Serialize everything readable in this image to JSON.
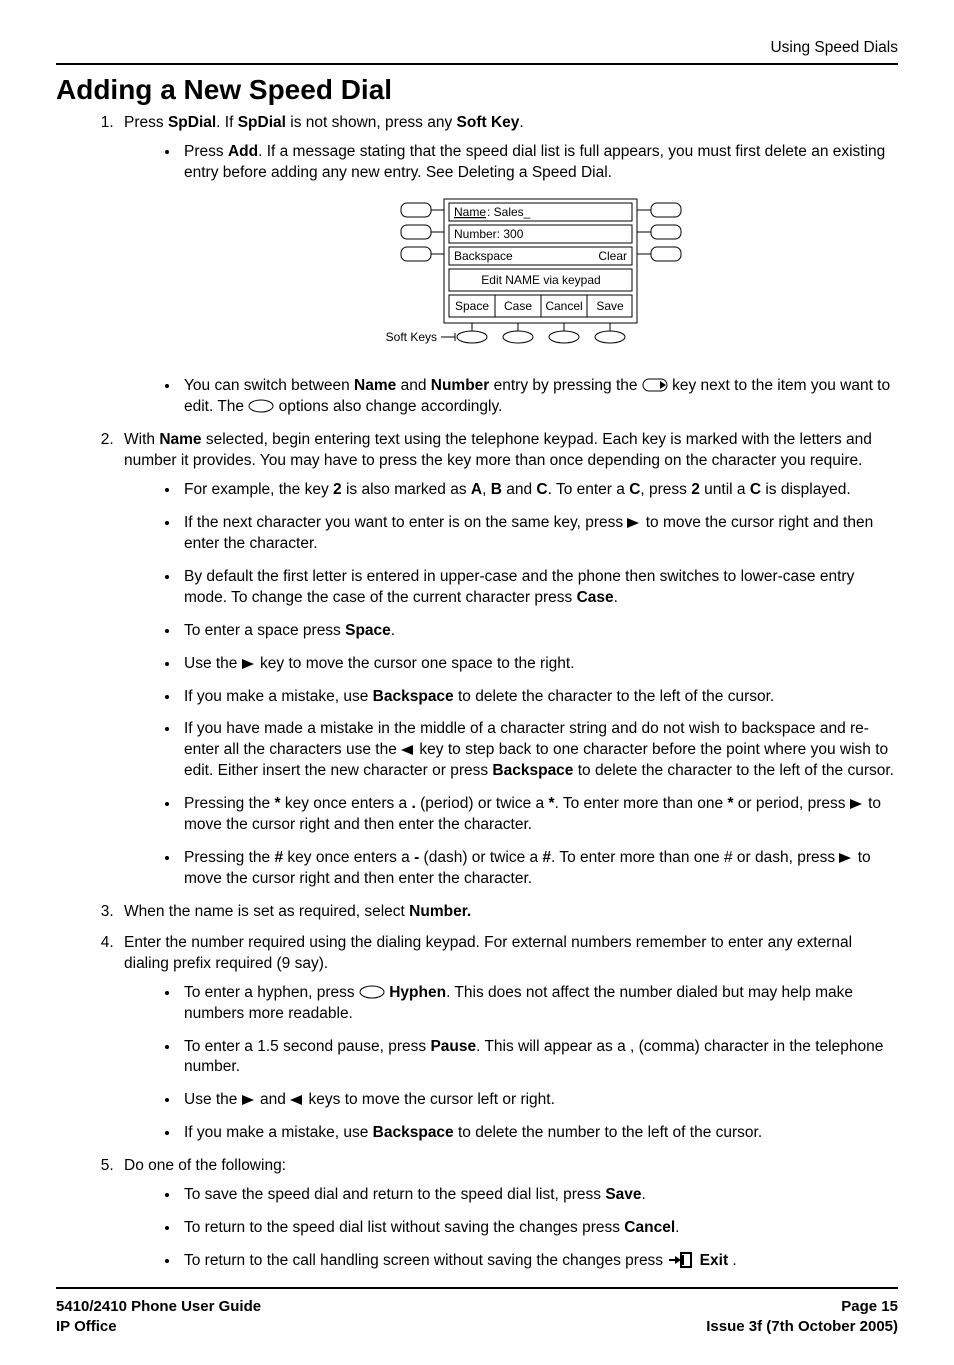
{
  "header": {
    "section": "Using Speed Dials"
  },
  "title": "Adding a New Speed Dial",
  "step1": {
    "line": {
      "p1": "Press ",
      "b1": "SpDial",
      "p2": ". If ",
      "b2": "SpDial",
      "p3": " is not shown, press any ",
      "b3": "Soft Key",
      "p4": "."
    },
    "bul1": {
      "p1": "Press ",
      "b1": "Add",
      "p2": ". If a message stating that the speed dial list is full appears, you must first delete an existing entry before adding any new entry. See Deleting a Speed Dial."
    },
    "bul2": {
      "p1": "You can switch between ",
      "b1": "Name",
      "p2": " and ",
      "b2": "Number",
      "p3": " entry by pressing the ",
      "p4": " key next to the item you want to edit. The ",
      "p5": " options also change accordingly."
    }
  },
  "figure": {
    "name_label": "Name",
    "name_val": ": Sales_",
    "number_line": "Number: 300",
    "backspace": "Backspace",
    "clear": "Clear",
    "mid_text": "Edit NAME via keypad",
    "k1": "Space",
    "k2": "Case",
    "k3": "Cancel",
    "k4": "Save",
    "softkeys_label": "Soft Keys"
  },
  "step2": {
    "line": {
      "p1": "With ",
      "b1": "Name",
      "p2": " selected, begin entering text using the telephone keypad. Each key is marked with the letters and number it provides. You may have to press the key more than once depending on the character you require."
    },
    "b1": {
      "p1": "For example, the key ",
      "bk": "2",
      "p2": " is also marked as ",
      "ba": "A",
      "p3": ", ",
      "bb": "B",
      "p4": " and ",
      "bc": "C",
      "p5": ". To enter a ",
      "bc2": "C",
      "p6": ", press ",
      "bk2": "2",
      "p7": " until a ",
      "bc3": "C",
      "p8": " is displayed."
    },
    "b2": {
      "p1": "If the next character you want to enter is on the same key, press ",
      "p2": " to move the cursor right and then enter the character."
    },
    "b3": {
      "p1": "By default the first letter is entered in upper-case and the phone then switches to lower-case entry mode. To change the case of the current character press ",
      "b": "Case",
      "p2": "."
    },
    "b4": {
      "p1": "To enter a space press ",
      "b": "Space",
      "p2": "."
    },
    "b5": {
      "p1": "Use the ",
      "p2": " key to move the cursor one space to the right."
    },
    "b6": {
      "p1": "If you make a mistake, use ",
      "b": "Backspace",
      "p2": " to delete the character to the left of the cursor."
    },
    "b7": {
      "p1": "If you have made a mistake in the middle of a character string and do not wish to backspace and re-enter all the characters use the ",
      "p2": " key to step back to one character before the point where you wish to edit. Either insert the new character or press ",
      "b": "Backspace",
      "p3": " to delete the character to the left of the cursor."
    },
    "b8": {
      "p1": "Pressing the ",
      "b1": "*",
      "p2": " key once enters a ",
      "b2": ".",
      "p3": " (period) or twice a ",
      "b3": "*",
      "p4": ". To enter more than one ",
      "b4": "*",
      "p5": " or period, press ",
      "p6": " to move the cursor right and then enter the character."
    },
    "b9": {
      "p1": "Pressing the ",
      "b1": "#",
      "p2": " key once enters a ",
      "b2": "-",
      "p3": " (dash) or twice a ",
      "b3": "#",
      "p4": ". To enter more than one # or dash, press ",
      "p5": " to move the cursor right and then enter the character."
    }
  },
  "step3": {
    "p1": "When the name is set as required, select ",
    "b": "Number."
  },
  "step4": {
    "line": "Enter the number required using the dialing keypad. For external numbers remember to enter any external dialing prefix required (9 say).",
    "b1": {
      "p1": "To enter a hyphen, press ",
      "b": " Hyphen",
      "p2": ". This does not affect the number dialed but may help make numbers more readable."
    },
    "b2": {
      "p1": "To enter a 1.5 second pause, press ",
      "b": "Pause",
      "p2": ". This will appear as a , (comma) character in the telephone number."
    },
    "b3": {
      "p1": "Use the ",
      "p2": " and ",
      "p3": " keys to move the cursor left or right."
    },
    "b4": {
      "p1": "If you make a mistake, use ",
      "b": "Backspace",
      "p2": " to delete the number to the left of the cursor."
    }
  },
  "step5": {
    "line": "Do one of the following:",
    "b1": {
      "p1": "To save the speed dial and return to the speed dial list, press ",
      "b": "Save",
      "p2": "."
    },
    "b2": {
      "p1": "To return to the speed dial list without saving the changes press ",
      "b": "Cancel",
      "p2": "."
    },
    "b3": {
      "p1": "To return to the call handling screen without saving the changes press ",
      "b": " Exit",
      "p2": " ."
    }
  },
  "footer": {
    "l1": "5410/2410 Phone User Guide",
    "l2": "IP Office",
    "r1": "Page 15",
    "r2": "Issue 3f (7th October 2005)"
  }
}
